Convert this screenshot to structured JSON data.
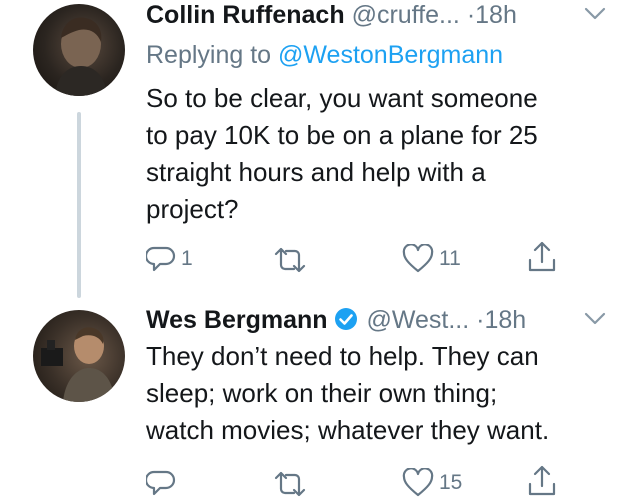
{
  "tweets": [
    {
      "name": "Collin Ruffenach",
      "handle": "@cruffe...",
      "time": "18h",
      "replying_prefix": "Replying to",
      "replying_to": "@WestonBergmann",
      "text": "So to be clear, you want someone\nto pay 10K to be on a plane for 25\nstraight hours and help with a\nproject?",
      "reply_count": "1",
      "retweet_count": "",
      "like_count": "11",
      "verified": false
    },
    {
      "name": "Wes Bergmann",
      "handle": "@West...",
      "time": "18h",
      "text": "They don’t need to help. They can\nsleep; work on their own thing;\nwatch movies; whatever they want.",
      "reply_count": "",
      "retweet_count": "",
      "like_count": "15",
      "verified": true
    }
  ],
  "separator": "·",
  "colors": {
    "text": "#14171a",
    "secondary": "#657786",
    "accent": "#1da1f2",
    "thread_line": "#ccd6dd"
  },
  "icons": [
    "reply-icon",
    "retweet-icon",
    "like-icon",
    "share-icon",
    "chevron-down-icon",
    "verified-icon"
  ]
}
